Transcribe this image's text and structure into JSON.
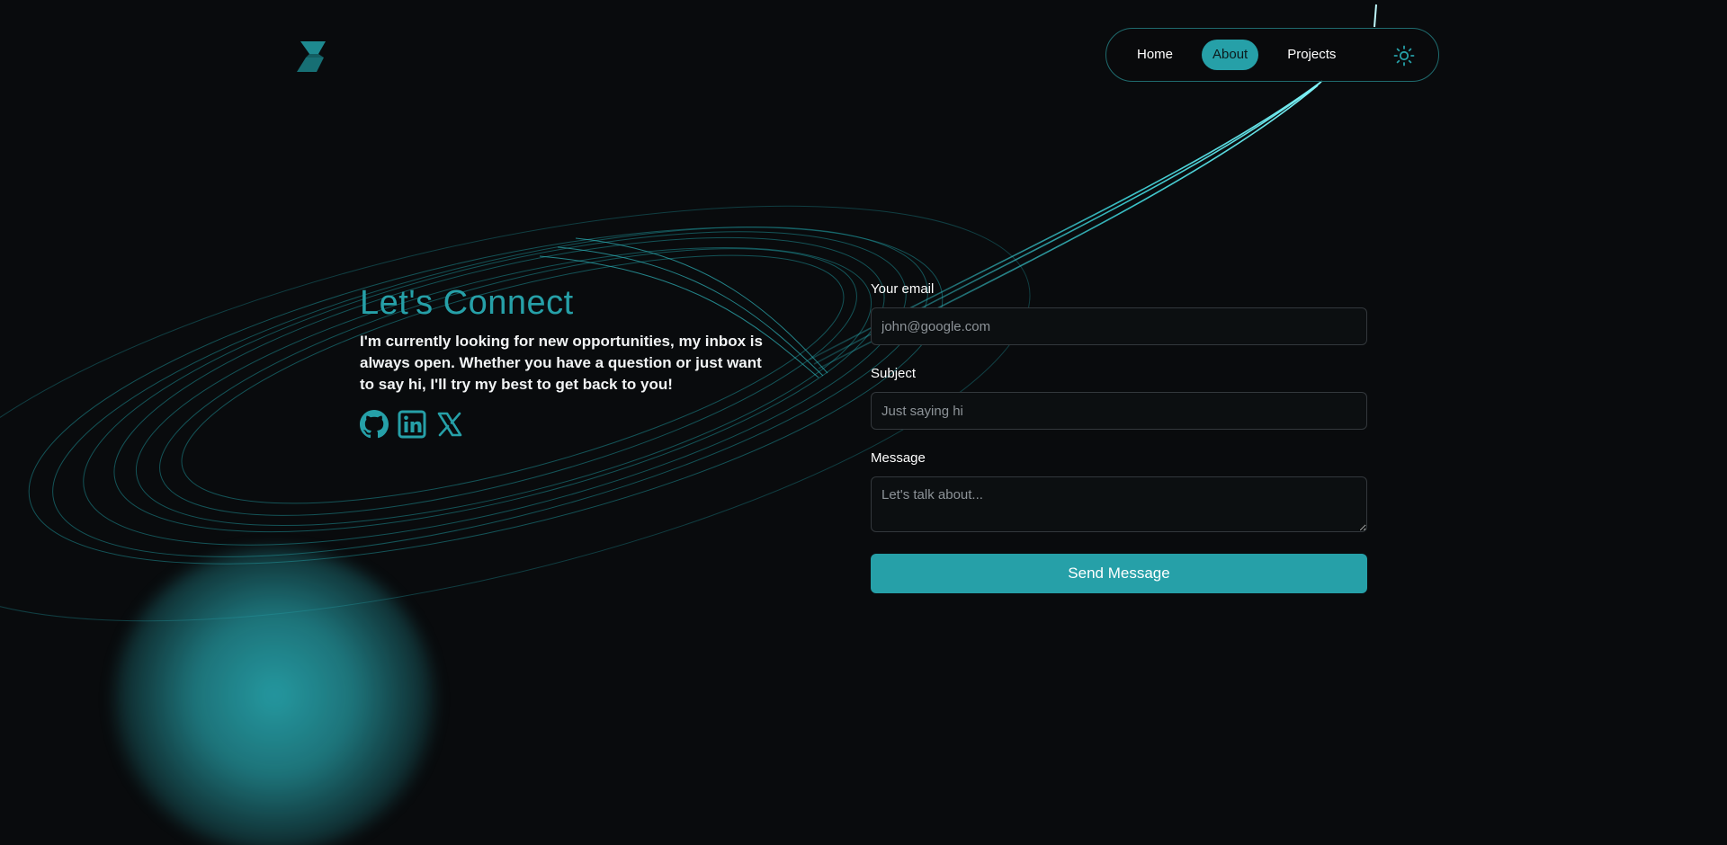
{
  "header": {
    "logo_icon": "s-logo-icon",
    "nav": {
      "items": [
        {
          "label": "Home",
          "active": false
        },
        {
          "label": "About",
          "active": true
        },
        {
          "label": "Projects",
          "active": false
        }
      ],
      "theme_toggle_icon": "sun-icon"
    }
  },
  "contact": {
    "title": "Let's Connect",
    "intro": "I'm currently looking for new opportunities, my inbox is always open. Whether you have a question or just want to say hi, I'll try my best to get back to you!",
    "socials": [
      {
        "icon": "github-icon"
      },
      {
        "icon": "linkedin-icon"
      },
      {
        "icon": "x-icon"
      }
    ]
  },
  "form": {
    "email": {
      "label": "Your email",
      "placeholder": "john@google.com",
      "value": ""
    },
    "subject": {
      "label": "Subject",
      "placeholder": "Just saying hi",
      "value": ""
    },
    "message": {
      "label": "Message",
      "placeholder": "Let's talk about...",
      "value": ""
    },
    "submit_label": "Send Message"
  },
  "colors": {
    "accent": "#26a0a8",
    "background": "#090b0d",
    "text": "#ffffff"
  }
}
